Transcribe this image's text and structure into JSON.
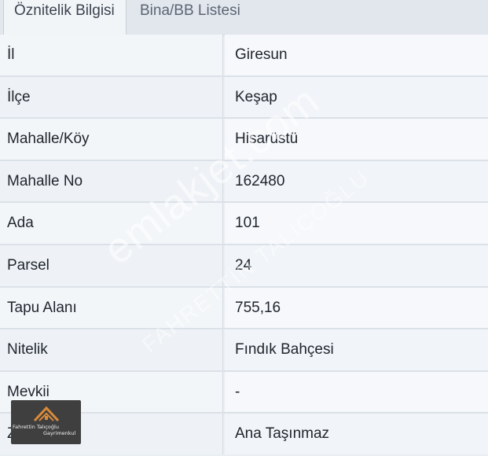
{
  "tabs": [
    {
      "label": "Öznitelik Bilgisi",
      "active": true
    },
    {
      "label": "Bina/BB Listesi",
      "active": false
    }
  ],
  "rows": [
    {
      "key": "İl",
      "value": "Giresun"
    },
    {
      "key": "İlçe",
      "value": "Keşap"
    },
    {
      "key": "Mahalle/Köy",
      "value": "Hisarüstü"
    },
    {
      "key": "Mahalle No",
      "value": "162480"
    },
    {
      "key": "Ada",
      "value": "101"
    },
    {
      "key": "Parsel",
      "value": "24"
    },
    {
      "key": "Tapu Alanı",
      "value": "755,16"
    },
    {
      "key": "Nitelik",
      "value": "Fındık Bahçesi"
    },
    {
      "key": "Mevkii",
      "value": "-"
    },
    {
      "key": "Zemin Tip",
      "value": "Ana Taşınmaz"
    }
  ],
  "watermark": {
    "text": "emlakjet.com",
    "sub": "FAHRETTİN TALIÇOĞLU"
  },
  "logo": {
    "line1": "Fahrettin Talıçoğlu",
    "line2": "Gayrimenkul"
  },
  "colors": {
    "logo_bg": "#3f3f3f",
    "logo_roof": "#d98a3a"
  }
}
